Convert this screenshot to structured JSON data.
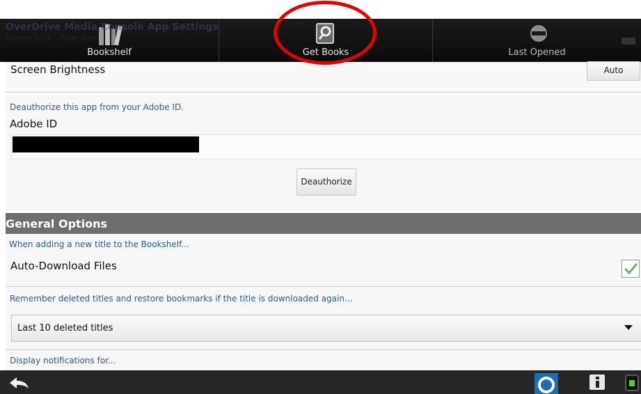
{
  "header": {
    "ghost_title": "OverDrive Media Console App Settings",
    "ghost_subtitle": "Screen Lock - Page Turn"
  },
  "tabs": [
    {
      "label": "Bookshelf",
      "icon": "books-icon"
    },
    {
      "label": "Get Books",
      "icon": "search-book-icon"
    },
    {
      "label": "Last Opened",
      "icon": "no-entry-icon"
    }
  ],
  "brightness": {
    "label": "Screen Brightness",
    "button": "Auto"
  },
  "adobe": {
    "hint": "Deauthorize this app from your Adobe ID.",
    "label": "Adobe ID",
    "button": "Deauthorize"
  },
  "general": {
    "header": "General Options",
    "adding_hint": "When adding a new title to the Bookshelf...",
    "auto_download_label": "Auto-Download Files",
    "auto_download_checked": true,
    "remember_hint": "Remember deleted titles and restore bookmarks if the title is downloaded again...",
    "remember_selected": "Last 10 deleted titles",
    "notifications_hint": "Display notifications for..."
  },
  "annotation": {
    "color": "#e30000"
  }
}
